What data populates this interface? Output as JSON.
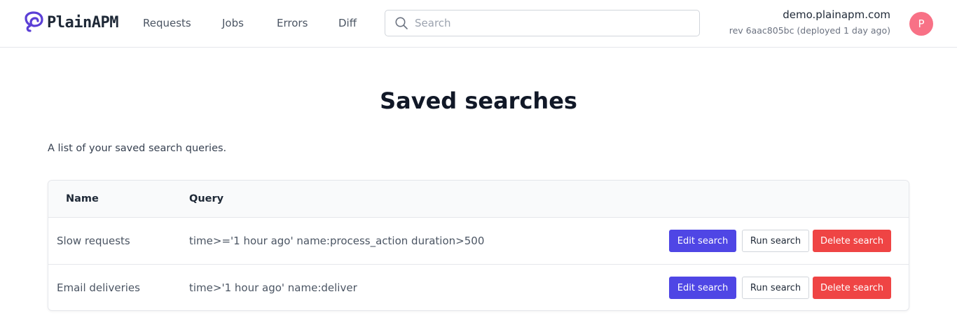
{
  "app": {
    "logo_text": "PlainAPM",
    "accent_color": "#4f46e5",
    "danger_color": "#ef4444"
  },
  "nav": {
    "items": [
      {
        "label": "Requests"
      },
      {
        "label": "Jobs"
      },
      {
        "label": "Errors"
      },
      {
        "label": "Diff"
      }
    ]
  },
  "search": {
    "placeholder": "Search",
    "value": "",
    "icon": "search-icon"
  },
  "site": {
    "domain": "demo.plainapm.com",
    "revision": "rev 6aac805bc (deployed 1 day ago)"
  },
  "user": {
    "avatar_initial": "P",
    "avatar_color": "#f87186"
  },
  "main": {
    "title": "Saved searches",
    "description": "A list of your saved search queries."
  },
  "table": {
    "columns": [
      "Name",
      "Query"
    ],
    "rows": [
      {
        "name": "Slow requests",
        "query": "time>='1 hour ago' name:process_action duration>500",
        "edit_label": "Edit search",
        "run_label": "Run search",
        "delete_label": "Delete search"
      },
      {
        "name": "Email deliveries",
        "query": "time>'1 hour ago' name:deliver",
        "edit_label": "Edit search",
        "run_label": "Run search",
        "delete_label": "Delete search"
      }
    ]
  }
}
